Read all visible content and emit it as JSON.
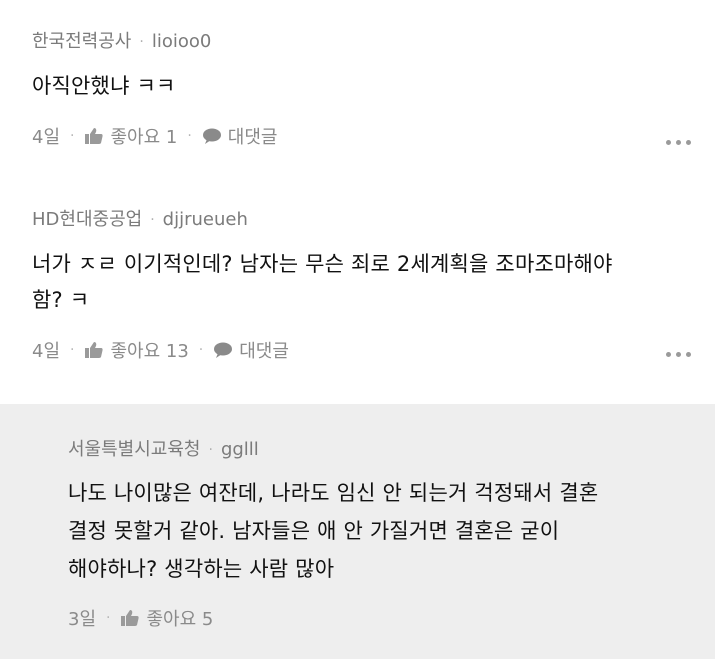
{
  "comments": [
    {
      "org": "한국전력공사",
      "user": "lioioo0",
      "text_lines": [
        "아직안했냐 ㅋㅋ"
      ],
      "age": "4일",
      "likes_label": "좋아요 1",
      "reply_label": "대댓글"
    },
    {
      "org": "HD현대중공업",
      "user": "djjrueueh",
      "text_lines": [
        "너가 ㅈㄹ 이기적인데? 남자는 무슨 죄로 2세계획을 조마조마해야",
        "함? ㅋ"
      ],
      "age": "4일",
      "likes_label": "좋아요 13",
      "reply_label": "대댓글"
    },
    {
      "org": "서울특별시교육청",
      "user": "gglll",
      "text_lines": [
        "나도 나이많은 여잔데, 나라도 임신 안 되는거 걱정돼서 결혼",
        "결정 못할거 같아. 남자들은  애 안 가질거면  결혼은 굳이",
        "해야하나? 생각하는 사람 많아"
      ],
      "age": "3일",
      "likes_label": "좋아요 5"
    }
  ],
  "icons": {
    "like": "thumbs-up-icon",
    "reply": "speech-bubble-icon",
    "more": "more-dots-icon"
  },
  "colors": {
    "reply_background": "#eeeeee",
    "meta_text": "#7b7b7b"
  }
}
